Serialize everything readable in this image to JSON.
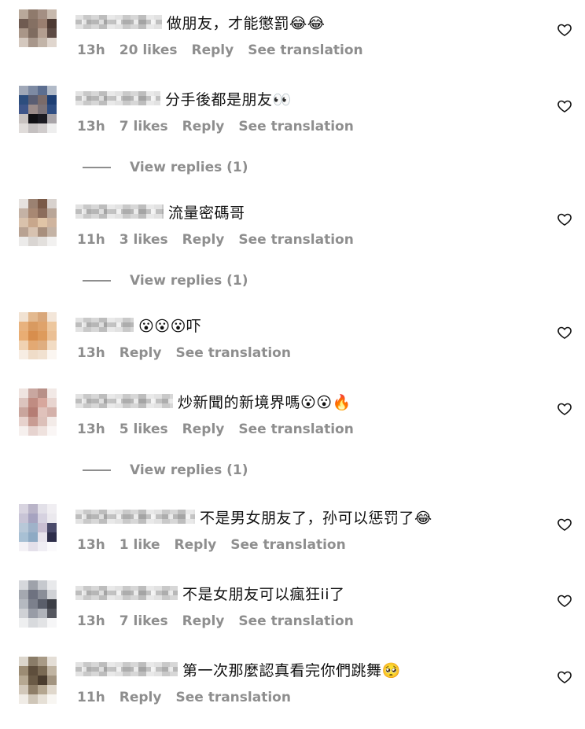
{
  "comments": [
    {
      "text": "做朋友，才能懲罰😂😂",
      "time": "13h",
      "likes": "20 likes",
      "reply": "Reply",
      "translate": "See translation",
      "avatar_colors": [
        "#b8a89a",
        "#8f7a6c",
        "#a48f83",
        "#c7b9ad",
        "#6f5b51",
        "#857063",
        "#9a7f70",
        "#4d3a33",
        "#a99688",
        "#7f6c60",
        "#b39e90",
        "#5d4b44",
        "#d4c8be",
        "#a8978b",
        "#c2b4a8",
        "#e0d6ce"
      ]
    },
    {
      "text": "分手後都是朋友👀",
      "time": "13h",
      "likes": "7 likes",
      "reply": "Reply",
      "translate": "See translation",
      "replies": "View replies (1)",
      "avatar_colors": [
        "#a0a8b8",
        "#7d8aa3",
        "#5c6e90",
        "#b1bac8",
        "#2d4e7e",
        "#5a5e73",
        "#7a6b6a",
        "#1e3f74",
        "#3f568a",
        "#9b8c8a",
        "#7b7379",
        "#2f4e83",
        "#c8c2c0",
        "#101014",
        "#1b1b22",
        "#a8a4a8",
        "#e0dcda",
        "#c4c0c0",
        "#d0cccc",
        "#eeeeee"
      ]
    },
    {
      "text": "流量密碼哥",
      "time": "11h",
      "likes": "3 likes",
      "reply": "Reply",
      "translate": "See translation",
      "replies": "View replies (1)",
      "avatar_colors": [
        "#e6e2df",
        "#9b8272",
        "#7a5a48",
        "#d8d2ce",
        "#c4b2a5",
        "#a88873",
        "#8c6d5c",
        "#b9a698",
        "#d9c2ac",
        "#c8a78c",
        "#e0c4a6",
        "#cfb49e",
        "#b8a292",
        "#d7c2b0",
        "#a88f7d",
        "#c4b3a5",
        "#ecebea",
        "#d9d5d2",
        "#e3e0dd",
        "#f2f1f0"
      ]
    },
    {
      "text": "😮😮😮吓",
      "time": "13h",
      "reply": "Reply",
      "translate": "See translation",
      "avatar_colors": [
        "#f1e2d2",
        "#e3b98f",
        "#d9a77a",
        "#f3e6d9",
        "#e8b27e",
        "#d99a60",
        "#dfa36b",
        "#edc79e",
        "#e9ad73",
        "#d88e4d",
        "#de9b5c",
        "#ebc095",
        "#f0d2b2",
        "#e3a973",
        "#dfae80",
        "#f2dcc4",
        "#f7ede3",
        "#efdcc8",
        "#f1e1d0",
        "#fbf6f1"
      ]
    },
    {
      "text": "炒新聞的新境界嗎😮😮🔥",
      "time": "13h",
      "likes": "5 likes",
      "reply": "Reply",
      "translate": "See translation",
      "replies": "View replies (1)",
      "avatar_colors": [
        "#efe4e0",
        "#c9a7a0",
        "#b89088",
        "#f2e9e6",
        "#dcc4be",
        "#c08c82",
        "#d7a79d",
        "#e8d5d0",
        "#c9a59d",
        "#b57d74",
        "#e0c2bb",
        "#d4b1aa",
        "#e7d2cd",
        "#c89c93",
        "#dcc0b9",
        "#f3ebe8",
        "#f6f0ee",
        "#e6d3cf",
        "#efe2de",
        "#faf6f5"
      ]
    },
    {
      "text": "不是男女朋友了，孙可以惩罚了😂",
      "time": "13h",
      "likes": "1 like",
      "reply": "Reply",
      "translate": "See translation",
      "avatar_colors": [
        "#d8d4e0",
        "#b9b4c8",
        "#e2e0e8",
        "#f0eef2",
        "#c8c4d6",
        "#a6a3c0",
        "#d6d2e0",
        "#ebe9ee",
        "#b8c8d8",
        "#9fb2c9",
        "#c9bfd2",
        "#4a4a6a",
        "#a8c0d4",
        "#8eaac4",
        "#e8e4ec",
        "#2e2e4a",
        "#f4f2f6",
        "#e4e0ea",
        "#f0eef4",
        "#fbfafc"
      ]
    },
    {
      "text": "不是女朋友可以瘋狂ii了",
      "time": "13h",
      "likes": "7 likes",
      "reply": "Reply",
      "translate": "See translation",
      "avatar_colors": [
        "#d6d8dc",
        "#9ea2aa",
        "#c6c9ce",
        "#e8e9eb",
        "#a4a8b0",
        "#6e7280",
        "#8a8e98",
        "#d0d2d6",
        "#b5b9c0",
        "#7c808c",
        "#5a5e6a",
        "#3c3e46",
        "#cfd1d5",
        "#989ca6",
        "#b0b3ba",
        "#54565e",
        "#eeeff0",
        "#d8dadd",
        "#e2e3e5",
        "#f6f6f7"
      ]
    },
    {
      "text": "第一次那麼認真看完你們跳舞🥺",
      "time": "11h",
      "reply": "Reply",
      "translate": "See translation",
      "avatar_colors": [
        "#dcd6cc",
        "#8a7c68",
        "#a89a86",
        "#e4ded6",
        "#9c8c74",
        "#5e4e3c",
        "#7a6a54",
        "#c0b4a2",
        "#b6a892",
        "#6a5a46",
        "#4a3c2e",
        "#a29480",
        "#d2c8ba",
        "#8e7e68",
        "#b4a690",
        "#e0d8cc",
        "#f0ece6",
        "#cfc6b8",
        "#e6e0d6",
        "#f8f6f2"
      ]
    }
  ]
}
